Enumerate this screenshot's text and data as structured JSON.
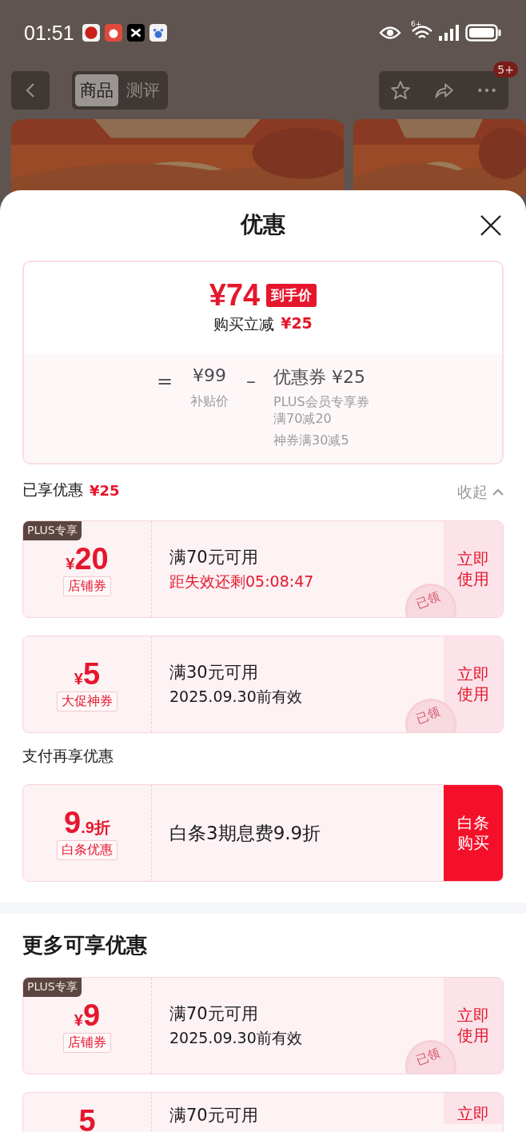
{
  "status_bar": {
    "time": "01:51",
    "wifi_badge": "6+"
  },
  "nav": {
    "tabs": [
      {
        "label": "商品",
        "selected": true
      },
      {
        "label": "测评",
        "selected": false
      }
    ],
    "badge": "5+"
  },
  "sheet": {
    "title": "优惠",
    "summary": {
      "price": "¥74",
      "price_tag": "到手价",
      "reduction_label": "购买立减",
      "reduction": "¥25",
      "equals": "=",
      "base_price": "¥99",
      "base_label": "补贴价",
      "minus": "–",
      "discount": "优惠券 ¥25",
      "notes": [
        "PLUS会员专享券满70减20",
        "神券满30减5"
      ]
    },
    "enjoyed": {
      "label": "已享优惠",
      "amount": "¥25",
      "collapse": "收起"
    },
    "coupons": [
      {
        "kind": "coupon",
        "tag": "PLUS专享",
        "currency": "¥",
        "amount": "20",
        "type_label": "店铺券",
        "condition": "满70元可用",
        "validity": "距失效还剩05:08:47",
        "urgent": true,
        "action": "立即使用",
        "stamp": "已领"
      },
      {
        "kind": "coupon",
        "currency": "¥",
        "amount": "5",
        "type_label": "大促神券",
        "condition": "满30元可用",
        "validity": "2025.09.30前有效",
        "urgent": false,
        "action": "立即使用",
        "stamp": "已领"
      }
    ],
    "payment_title": "支付再享优惠",
    "payment": [
      {
        "kind": "discount",
        "amount": "9",
        "amount_suffix": ".9折",
        "type_label": "白条优惠",
        "condition": "白条3期息费9.9折",
        "action": "白条购买"
      }
    ],
    "more_title": "更多可享优惠",
    "more": [
      {
        "kind": "coupon",
        "tag": "PLUS专享",
        "currency": "¥",
        "amount": "9",
        "type_label": "店铺券",
        "condition": "满70元可用",
        "validity": "2025.09.30前有效",
        "urgent": false,
        "action": "立即使用",
        "stamp": "已领"
      },
      {
        "kind": "coupon",
        "amount": "5",
        "condition": "满70元可用",
        "action": "立即"
      }
    ]
  }
}
